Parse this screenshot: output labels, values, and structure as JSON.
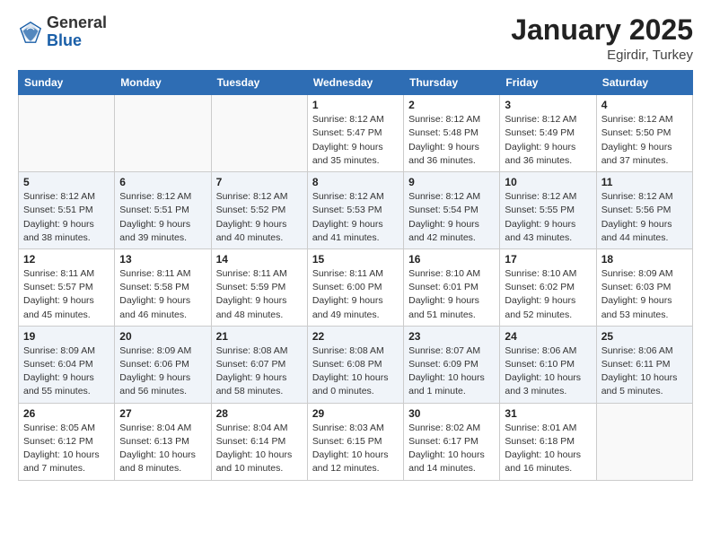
{
  "logo": {
    "general": "General",
    "blue": "Blue"
  },
  "title": "January 2025",
  "subtitle": "Egirdir, Turkey",
  "days_of_week": [
    "Sunday",
    "Monday",
    "Tuesday",
    "Wednesday",
    "Thursday",
    "Friday",
    "Saturday"
  ],
  "weeks": [
    [
      {
        "day": "",
        "info": ""
      },
      {
        "day": "",
        "info": ""
      },
      {
        "day": "",
        "info": ""
      },
      {
        "day": "1",
        "info": "Sunrise: 8:12 AM\nSunset: 5:47 PM\nDaylight: 9 hours\nand 35 minutes."
      },
      {
        "day": "2",
        "info": "Sunrise: 8:12 AM\nSunset: 5:48 PM\nDaylight: 9 hours\nand 36 minutes."
      },
      {
        "day": "3",
        "info": "Sunrise: 8:12 AM\nSunset: 5:49 PM\nDaylight: 9 hours\nand 36 minutes."
      },
      {
        "day": "4",
        "info": "Sunrise: 8:12 AM\nSunset: 5:50 PM\nDaylight: 9 hours\nand 37 minutes."
      }
    ],
    [
      {
        "day": "5",
        "info": "Sunrise: 8:12 AM\nSunset: 5:51 PM\nDaylight: 9 hours\nand 38 minutes."
      },
      {
        "day": "6",
        "info": "Sunrise: 8:12 AM\nSunset: 5:51 PM\nDaylight: 9 hours\nand 39 minutes."
      },
      {
        "day": "7",
        "info": "Sunrise: 8:12 AM\nSunset: 5:52 PM\nDaylight: 9 hours\nand 40 minutes."
      },
      {
        "day": "8",
        "info": "Sunrise: 8:12 AM\nSunset: 5:53 PM\nDaylight: 9 hours\nand 41 minutes."
      },
      {
        "day": "9",
        "info": "Sunrise: 8:12 AM\nSunset: 5:54 PM\nDaylight: 9 hours\nand 42 minutes."
      },
      {
        "day": "10",
        "info": "Sunrise: 8:12 AM\nSunset: 5:55 PM\nDaylight: 9 hours\nand 43 minutes."
      },
      {
        "day": "11",
        "info": "Sunrise: 8:12 AM\nSunset: 5:56 PM\nDaylight: 9 hours\nand 44 minutes."
      }
    ],
    [
      {
        "day": "12",
        "info": "Sunrise: 8:11 AM\nSunset: 5:57 PM\nDaylight: 9 hours\nand 45 minutes."
      },
      {
        "day": "13",
        "info": "Sunrise: 8:11 AM\nSunset: 5:58 PM\nDaylight: 9 hours\nand 46 minutes."
      },
      {
        "day": "14",
        "info": "Sunrise: 8:11 AM\nSunset: 5:59 PM\nDaylight: 9 hours\nand 48 minutes."
      },
      {
        "day": "15",
        "info": "Sunrise: 8:11 AM\nSunset: 6:00 PM\nDaylight: 9 hours\nand 49 minutes."
      },
      {
        "day": "16",
        "info": "Sunrise: 8:10 AM\nSunset: 6:01 PM\nDaylight: 9 hours\nand 51 minutes."
      },
      {
        "day": "17",
        "info": "Sunrise: 8:10 AM\nSunset: 6:02 PM\nDaylight: 9 hours\nand 52 minutes."
      },
      {
        "day": "18",
        "info": "Sunrise: 8:09 AM\nSunset: 6:03 PM\nDaylight: 9 hours\nand 53 minutes."
      }
    ],
    [
      {
        "day": "19",
        "info": "Sunrise: 8:09 AM\nSunset: 6:04 PM\nDaylight: 9 hours\nand 55 minutes."
      },
      {
        "day": "20",
        "info": "Sunrise: 8:09 AM\nSunset: 6:06 PM\nDaylight: 9 hours\nand 56 minutes."
      },
      {
        "day": "21",
        "info": "Sunrise: 8:08 AM\nSunset: 6:07 PM\nDaylight: 9 hours\nand 58 minutes."
      },
      {
        "day": "22",
        "info": "Sunrise: 8:08 AM\nSunset: 6:08 PM\nDaylight: 10 hours\nand 0 minutes."
      },
      {
        "day": "23",
        "info": "Sunrise: 8:07 AM\nSunset: 6:09 PM\nDaylight: 10 hours\nand 1 minute."
      },
      {
        "day": "24",
        "info": "Sunrise: 8:06 AM\nSunset: 6:10 PM\nDaylight: 10 hours\nand 3 minutes."
      },
      {
        "day": "25",
        "info": "Sunrise: 8:06 AM\nSunset: 6:11 PM\nDaylight: 10 hours\nand 5 minutes."
      }
    ],
    [
      {
        "day": "26",
        "info": "Sunrise: 8:05 AM\nSunset: 6:12 PM\nDaylight: 10 hours\nand 7 minutes."
      },
      {
        "day": "27",
        "info": "Sunrise: 8:04 AM\nSunset: 6:13 PM\nDaylight: 10 hours\nand 8 minutes."
      },
      {
        "day": "28",
        "info": "Sunrise: 8:04 AM\nSunset: 6:14 PM\nDaylight: 10 hours\nand 10 minutes."
      },
      {
        "day": "29",
        "info": "Sunrise: 8:03 AM\nSunset: 6:15 PM\nDaylight: 10 hours\nand 12 minutes."
      },
      {
        "day": "30",
        "info": "Sunrise: 8:02 AM\nSunset: 6:17 PM\nDaylight: 10 hours\nand 14 minutes."
      },
      {
        "day": "31",
        "info": "Sunrise: 8:01 AM\nSunset: 6:18 PM\nDaylight: 10 hours\nand 16 minutes."
      },
      {
        "day": "",
        "info": ""
      }
    ]
  ]
}
